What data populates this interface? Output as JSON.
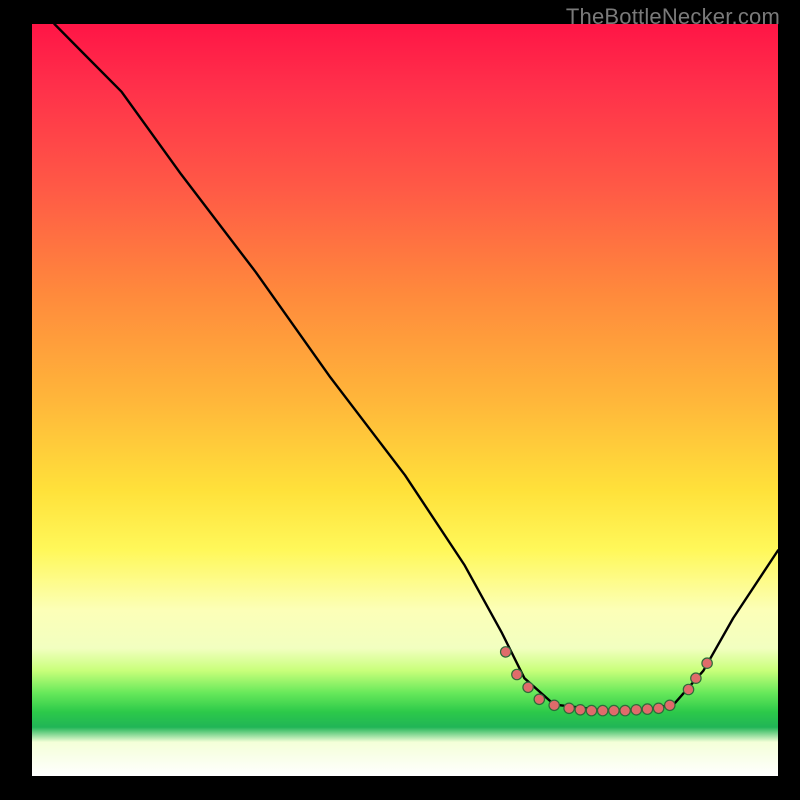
{
  "watermark": "TheBottleNecker.com",
  "chart_data": {
    "type": "line",
    "title": "",
    "xlabel": "",
    "ylabel": "",
    "x_range": [
      0,
      100
    ],
    "y_range": [
      0,
      100
    ],
    "note": "Axes are not labeled; values are normalized 0–100. Background hue maps y (top=red=100 → bottom=green≈10 → white=0). Curve starts near (3,100), descends roughly linearly to a flat minimum around x≈68–86 at y≈9, then rises to (100,~30). Dots are clustered near the minimum.",
    "curve_points_norm": [
      {
        "x": 3,
        "y": 100
      },
      {
        "x": 7,
        "y": 96
      },
      {
        "x": 12,
        "y": 91
      },
      {
        "x": 20,
        "y": 80
      },
      {
        "x": 30,
        "y": 67
      },
      {
        "x": 40,
        "y": 53
      },
      {
        "x": 50,
        "y": 40
      },
      {
        "x": 58,
        "y": 28
      },
      {
        "x": 63,
        "y": 19
      },
      {
        "x": 66,
        "y": 13
      },
      {
        "x": 70,
        "y": 9.5
      },
      {
        "x": 76,
        "y": 8.8
      },
      {
        "x": 82,
        "y": 8.8
      },
      {
        "x": 86,
        "y": 9.5
      },
      {
        "x": 90,
        "y": 14
      },
      {
        "x": 94,
        "y": 21
      },
      {
        "x": 100,
        "y": 30
      }
    ],
    "dots_norm": [
      {
        "x": 63.5,
        "y": 16.5
      },
      {
        "x": 65.0,
        "y": 13.5
      },
      {
        "x": 66.5,
        "y": 11.8
      },
      {
        "x": 68.0,
        "y": 10.2
      },
      {
        "x": 70.0,
        "y": 9.4
      },
      {
        "x": 72.0,
        "y": 9.0
      },
      {
        "x": 73.5,
        "y": 8.8
      },
      {
        "x": 75.0,
        "y": 8.7
      },
      {
        "x": 76.5,
        "y": 8.7
      },
      {
        "x": 78.0,
        "y": 8.7
      },
      {
        "x": 79.5,
        "y": 8.7
      },
      {
        "x": 81.0,
        "y": 8.8
      },
      {
        "x": 82.5,
        "y": 8.9
      },
      {
        "x": 84.0,
        "y": 9.0
      },
      {
        "x": 85.5,
        "y": 9.4
      },
      {
        "x": 88.0,
        "y": 11.5
      },
      {
        "x": 89.0,
        "y": 13.0
      },
      {
        "x": 90.5,
        "y": 15.0
      }
    ],
    "gradient_hint": "value-to-color: 100→#ff1546, 60→#ffc23a, 30→#fff85a, 10→#2cc94a, 0→#ffffff"
  }
}
